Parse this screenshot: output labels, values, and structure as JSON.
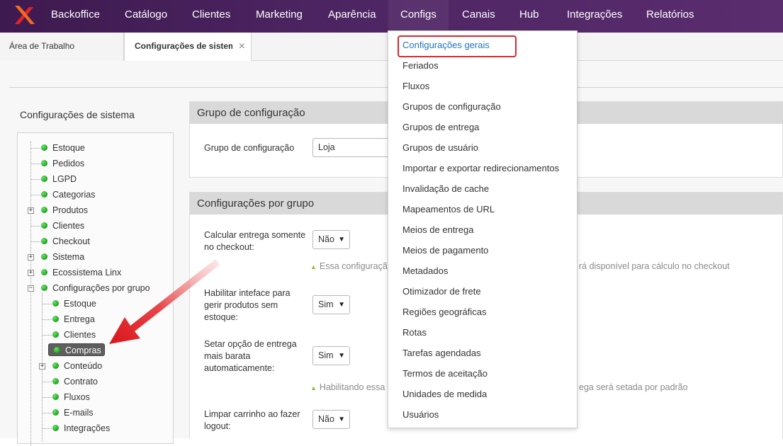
{
  "topnav": {
    "items": [
      {
        "label": "Backoffice"
      },
      {
        "label": "Catálogo"
      },
      {
        "label": "Clientes"
      },
      {
        "label": "Marketing"
      },
      {
        "label": "Aparência"
      },
      {
        "label": "Configs"
      },
      {
        "label": "Canais"
      },
      {
        "label": "Hub"
      },
      {
        "label": "Integrações"
      },
      {
        "label": "Relatórios"
      }
    ],
    "brand_color": "#4e2563",
    "logo_colors": [
      "#f26a21",
      "#e8202a"
    ]
  },
  "tabs": {
    "items": [
      {
        "label": "Área de Trabalho"
      },
      {
        "label": "Configurações de sistem"
      }
    ],
    "close_icon": "×"
  },
  "sidebar": {
    "title": "Configurações de sistema",
    "tree": [
      {
        "label": "Estoque"
      },
      {
        "label": "Pedidos"
      },
      {
        "label": "LGPD"
      },
      {
        "label": "Categorias"
      },
      {
        "label": "Produtos"
      },
      {
        "label": "Clientes"
      },
      {
        "label": "Checkout"
      },
      {
        "label": "Sistema"
      },
      {
        "label": "Ecossistema Linx"
      },
      {
        "label": "Configurações por grupo"
      },
      {
        "label": "Estoque"
      },
      {
        "label": "Entrega"
      },
      {
        "label": "Clientes"
      },
      {
        "label": "Compras"
      },
      {
        "label": "Conteúdo"
      },
      {
        "label": "Contrato"
      },
      {
        "label": "Fluxos"
      },
      {
        "label": "E-mails"
      },
      {
        "label": "Integrações"
      }
    ]
  },
  "group_panel": {
    "header": "Grupo de configuração",
    "field_label": "Grupo de configuração",
    "field_value": "Loja"
  },
  "config_panel": {
    "header": "Configurações por grupo",
    "fields": [
      {
        "label": "Calcular entrega somente no checkout:",
        "value": "Não",
        "hint_left": "Essa configuração,",
        "hint_right": "rá disponível para cálculo no checkout"
      },
      {
        "label": "Habilitar inteface para gerir produtos sem estoque:",
        "value": "Sim"
      },
      {
        "label": "Setar opção de entrega mais barata automaticamente:",
        "value": "Sim",
        "hint_left": "Habilitando essa o",
        "hint_right": "ega será setada por padrão"
      },
      {
        "label": "Limpar carrinho ao fazer logout:",
        "value": "Não"
      }
    ]
  },
  "configs_menu": {
    "items": [
      {
        "label": "Configurações gerais"
      },
      {
        "label": "Feriados"
      },
      {
        "label": "Fluxos"
      },
      {
        "label": "Grupos de configuração"
      },
      {
        "label": "Grupos de entrega"
      },
      {
        "label": "Grupos de usuário"
      },
      {
        "label": "Importar e exportar redirecionamentos"
      },
      {
        "label": "Invalidação de cache"
      },
      {
        "label": "Mapeamentos de URL"
      },
      {
        "label": "Meios de entrega"
      },
      {
        "label": "Meios de pagamento"
      },
      {
        "label": "Metadados"
      },
      {
        "label": "Otimizador de frete"
      },
      {
        "label": "Regiões geográficas"
      },
      {
        "label": "Rotas"
      },
      {
        "label": "Tarefas agendadas"
      },
      {
        "label": "Termos de aceitação"
      },
      {
        "label": "Unidades de medida"
      },
      {
        "label": "Usuários"
      }
    ],
    "highlight_color": "#e0242c",
    "link_color": "#1f74c2"
  },
  "annotation": {
    "arrow_color": "#e0242c"
  }
}
